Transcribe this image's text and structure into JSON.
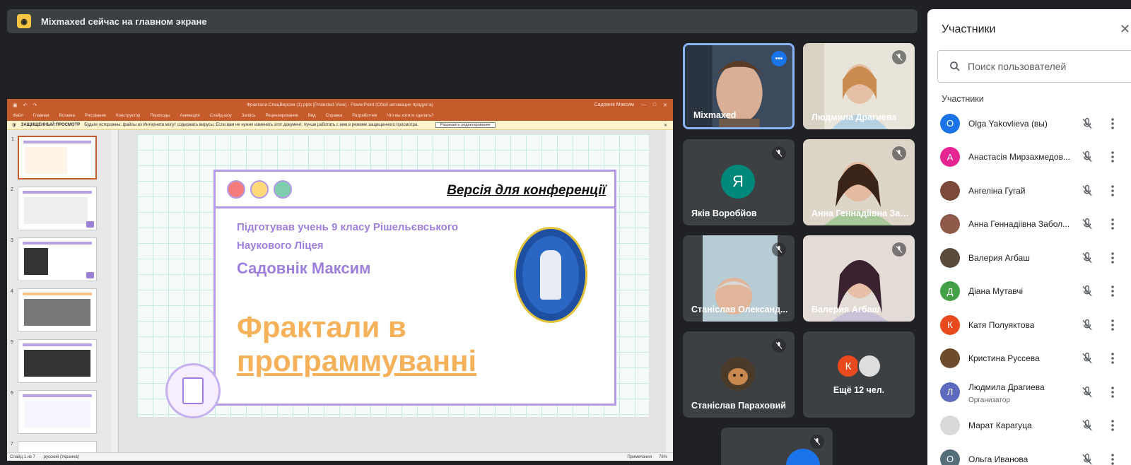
{
  "banner": {
    "text": "Mixmaxed сейчас на главном экране",
    "icon": "presenting-icon"
  },
  "presentation": {
    "window_title": "Фрактали.СпецВерсия (1).pptx [Protected View] - PowerPoint (Сбой активации продукта)",
    "user": "Садовнік Максим",
    "ribbon": [
      "Файл",
      "Главная",
      "Вставка",
      "Рисование",
      "Конструктор",
      "Переходы",
      "Анимация",
      "Слайд-шоу",
      "Запись",
      "Рецензирование",
      "Вид",
      "Справка",
      "Разработчик",
      "Что вы хотите сделать?"
    ],
    "warning_label": "ЗАЩИЩЕННЫЙ ПРОСМОТР",
    "warning_text": "Будьте осторожны: файлы из Интернета могут содержать вирусы. Если вам не нужно изменять этот документ, лучше работать с ним в режиме защищенного просмотра.",
    "enable_editing": "Разрешить редактирование",
    "status_left": "Слайд 1 из 7",
    "status_lang": "русский (Украина)",
    "status_notes": "Примечания",
    "status_zoom": "78%",
    "thumb_numbers": [
      "1",
      "2",
      "3",
      "4",
      "5",
      "6",
      "7"
    ],
    "slide": {
      "conf_title": "Версія для конференції",
      "prep_line1": "Підготував учень 9 класу Рішельєвського",
      "prep_line2": "Наукового Ліцея",
      "author": "Садовнік Максим",
      "title_line1": "Фрактали в",
      "title_line2": "программуванні",
      "dot_colors": [
        "#f47c7c",
        "#ffd97a",
        "#7fcfae"
      ],
      "accent": "#b49ae6"
    }
  },
  "tiles": [
    {
      "name": "Mixmaxed",
      "active": true
    },
    {
      "name": "Людмила Драгиева"
    },
    {
      "name": "Яків Воробйов",
      "initial": "Я"
    },
    {
      "name": "Анна Геннадіівна Заб..."
    },
    {
      "name": "Станіслав Олександ..."
    },
    {
      "name": "Валерия Агбаш"
    },
    {
      "name": "Станіслав Параховий"
    },
    {
      "name": "Ещё 12 чел.",
      "initial": "К"
    }
  ],
  "panel": {
    "title": "Участники",
    "search_placeholder": "Поиск пользователей",
    "section": "Участники",
    "participants": [
      {
        "name": "Olga Yakovlieva (вы)",
        "initial": "O",
        "color": "#1a73e8"
      },
      {
        "name": "Анастасія Мирзахмедов...",
        "initial": "А",
        "color": "#e52592"
      },
      {
        "name": "Ангеліна Гугай",
        "initial": "",
        "color": "#7b4a3a"
      },
      {
        "name": "Анна Геннадіівна Забол...",
        "initial": "",
        "color": "#8d5a4a"
      },
      {
        "name": "Валерия Агбаш",
        "initial": "",
        "color": "#5a4a3a"
      },
      {
        "name": "Діана Мутавчі",
        "initial": "Д",
        "color": "#43a047"
      },
      {
        "name": "Катя Полуяктова",
        "initial": "К",
        "color": "#e8491d"
      },
      {
        "name": "Кристина Руссева",
        "initial": "",
        "color": "#6d4b2b"
      },
      {
        "name": "Людмила Драгиева",
        "initial": "Л",
        "color": "#5c6bc0",
        "role": "Организатор"
      },
      {
        "name": "Марат Карагуца",
        "initial": "",
        "color": "#d9d9d9"
      },
      {
        "name": "Ольга Иванова",
        "initial": "О",
        "color": "#546e7a"
      }
    ]
  }
}
